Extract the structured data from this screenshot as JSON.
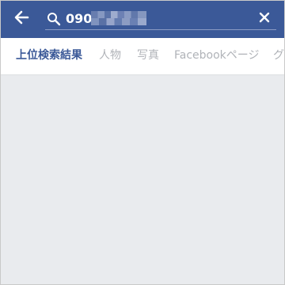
{
  "header": {
    "back_icon": "arrow-left-icon",
    "search_icon": "search-icon",
    "search_value": "090",
    "clear_icon": "close-icon",
    "bar_color": "#3b5998"
  },
  "tabs": [
    {
      "label": "上位検索結果",
      "active": true
    },
    {
      "label": "人物",
      "active": false
    },
    {
      "label": "写真",
      "active": false
    },
    {
      "label": "Facebookページ",
      "active": false
    },
    {
      "label": "グ",
      "active": false
    }
  ]
}
